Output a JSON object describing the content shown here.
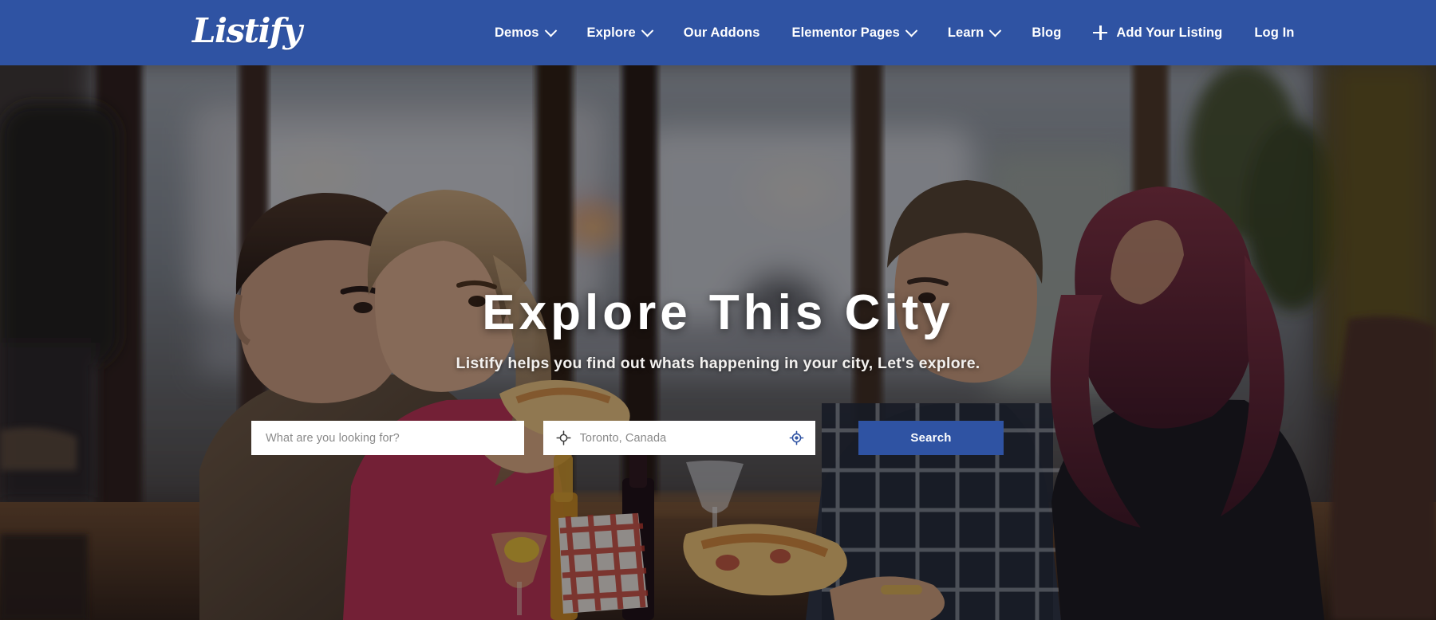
{
  "header": {
    "brand": "Listify",
    "brand_color": "#ffffff",
    "background_color": "#2f53a3",
    "nav": [
      {
        "label": "Demos",
        "icon": "chevron-down-icon",
        "has_dropdown": true,
        "name": "demos"
      },
      {
        "label": "Explore",
        "icon": "chevron-down-icon",
        "has_dropdown": true,
        "name": "explore"
      },
      {
        "label": "Our Addons",
        "icon": "",
        "has_dropdown": false,
        "name": "our-addons"
      },
      {
        "label": "Elementor Pages",
        "icon": "chevron-down-icon",
        "has_dropdown": true,
        "name": "elementor-pages"
      },
      {
        "label": "Learn",
        "icon": "chevron-down-icon",
        "has_dropdown": true,
        "name": "learn"
      },
      {
        "label": "Blog",
        "icon": "",
        "has_dropdown": false,
        "name": "blog"
      },
      {
        "label": "Add Your Listing",
        "icon": "plus-icon",
        "has_dropdown": false,
        "name": "add-your-listing"
      },
      {
        "label": "Log In",
        "icon": "",
        "has_dropdown": false,
        "name": "log-in"
      }
    ]
  },
  "hero": {
    "title": "Explore This City",
    "subtitle": "Listify helps you find out whats happening in your city, Let's explore.",
    "overlay_color": "rgba(12,10,18,0.40)"
  },
  "search": {
    "keyword_placeholder": "What are you looking for?",
    "keyword_value": "",
    "location_placeholder": "Toronto, Canada",
    "location_value": "",
    "location_icon": "crosshair-target-icon",
    "locate_icon": "gps-locate-icon",
    "locate_icon_color": "#2f53a3",
    "button_label": "Search",
    "button_color": "#2f53a3"
  }
}
